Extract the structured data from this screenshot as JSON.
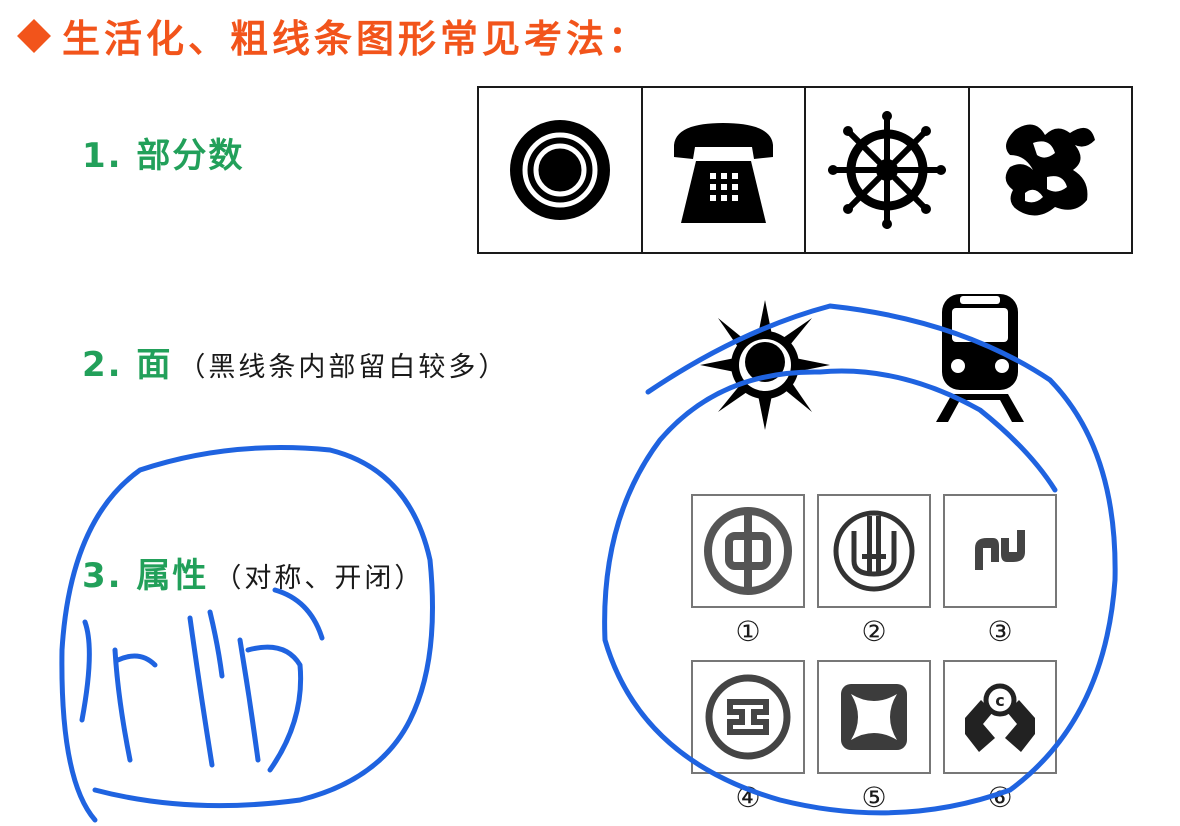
{
  "title": "生活化、粗线条图形常见考法：",
  "items": [
    {
      "label": "1. 部分数",
      "note": ""
    },
    {
      "label": "2. 面",
      "note": "（黑线条内部留白较多）"
    },
    {
      "label": "3. 属性",
      "note": "（对称、开闭）"
    }
  ],
  "strip_icons": [
    "target-icon",
    "telephone-icon",
    "ship-wheel-icon",
    "ornament-icon"
  ],
  "face_icons": [
    "sun-icon",
    "train-icon"
  ],
  "logo_numbers": [
    "①",
    "②",
    "③",
    "④",
    "⑤",
    "⑥"
  ],
  "handwriting": "识 门",
  "colors": {
    "title": "#f2541b",
    "item": "#22a05a",
    "ink": "#1f63e0"
  }
}
